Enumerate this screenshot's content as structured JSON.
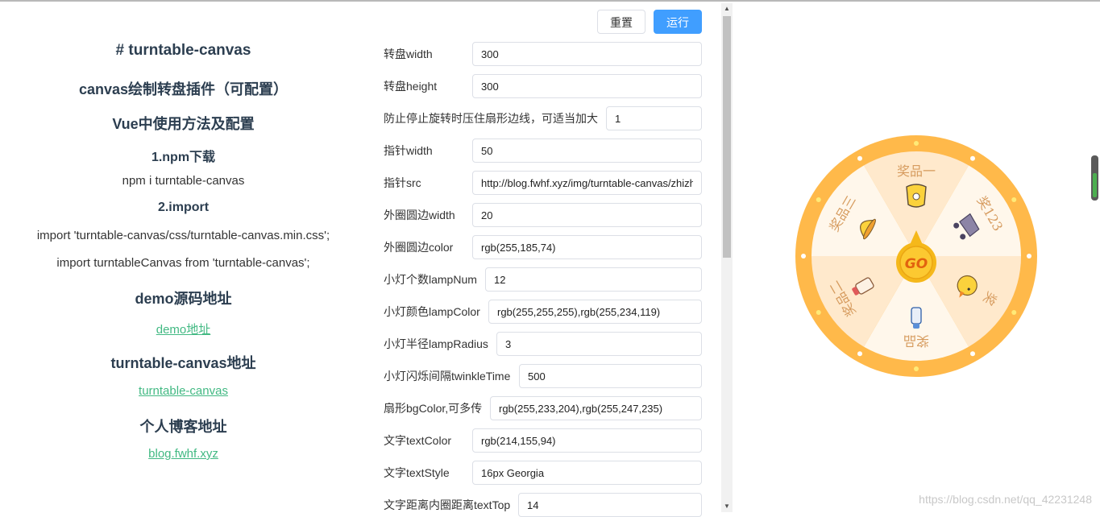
{
  "doc": {
    "title": "# turntable-canvas",
    "subtitle": "canvas绘制转盘插件（可配置）",
    "usage_heading": "Vue中使用方法及配置",
    "step1": "1.npm下载",
    "npm_cmd": "npm i turntable-canvas",
    "step2": "2.import",
    "import_css": "import 'turntable-canvas/css/turntable-canvas.min.css';",
    "import_js": "import turntableCanvas from 'turntable-canvas';",
    "demo_heading": "demo源码地址",
    "demo_link": "demo地址",
    "repo_heading": "turntable-canvas地址",
    "repo_link": "turntable-canvas",
    "blog_heading": "个人博客地址",
    "blog_link": "blog.fwhf.xyz"
  },
  "toolbar": {
    "reset_label": "重置",
    "run_label": "运行"
  },
  "config": [
    {
      "label": "转盘width",
      "value": "300"
    },
    {
      "label": "转盘height",
      "value": "300"
    },
    {
      "label": "防止停止旋转时压住扇形边线，可适当加大",
      "value": "1"
    },
    {
      "label": "指针width",
      "value": "50"
    },
    {
      "label": "指针src",
      "value": "http://blog.fwhf.xyz/img/turntable-canvas/zhizhen.png"
    },
    {
      "label": "外圈圆边width",
      "value": "20"
    },
    {
      "label": "外圈圆边color",
      "value": "rgb(255,185,74)"
    },
    {
      "label": "小灯个数lampNum",
      "value": "12"
    },
    {
      "label": "小灯颜色lampColor",
      "value": "rgb(255,255,255),rgb(255,234,119)"
    },
    {
      "label": "小灯半径lampRadius",
      "value": "3"
    },
    {
      "label": "小灯闪烁间隔twinkleTime",
      "value": "500"
    },
    {
      "label": "扇形bgColor,可多传",
      "value": "rgb(255,233,204),rgb(255,247,235)"
    },
    {
      "label": "文字textColor",
      "value": "rgb(214,155,94)"
    },
    {
      "label": "文字textStyle",
      "value": "16px Georgia"
    },
    {
      "label": "文字距离内圈距离textTop",
      "value": "14"
    }
  ],
  "wheel": {
    "prizes": [
      "奖品一",
      "奖123",
      "奖",
      "奖品",
      "奖品二",
      "奖品三"
    ],
    "pointer_text": "GO",
    "colors": {
      "ring": "#ffb94a",
      "sector_a": "#ffe9cc",
      "sector_b": "#fff7eb",
      "text": "#d69b5e",
      "lamp_a": "#ffffff",
      "lamp_b": "#ffea77",
      "pointer": "#f5b81a",
      "pointer_text": "#e2620f"
    }
  },
  "watermark": "https://blog.csdn.net/qq_42231248"
}
